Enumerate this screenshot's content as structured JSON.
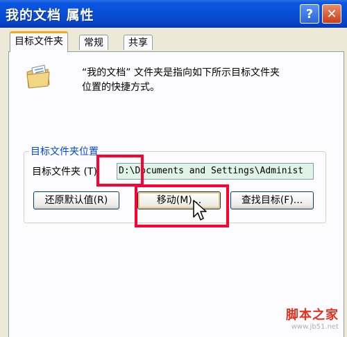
{
  "window": {
    "title": "我的文档 属性",
    "help_label": "?",
    "close_label": "✕"
  },
  "tabs": [
    {
      "label": "目标文件夹",
      "active": true
    },
    {
      "label": "常规",
      "active": false
    },
    {
      "label": "共享",
      "active": false
    }
  ],
  "content": {
    "icon": "folder-with-document-icon",
    "description_line1": "“我的文档” 文件夹是指向如下所示目标文件夹",
    "description_line2": "位置的快捷方式。"
  },
  "target_group": {
    "title": "目标文件夹位置",
    "label": "目标文件夹 (T):",
    "value": "D:\\Documents and Settings\\Administ"
  },
  "buttons": {
    "restore_default": "还原默认值(R)",
    "move": "移动(M)...",
    "find_target": "查找目标(F)..."
  },
  "annotations": {
    "highlight_color": "#ff0033"
  },
  "watermark": {
    "text": "脚本之家",
    "url": "www.jb51.net"
  }
}
